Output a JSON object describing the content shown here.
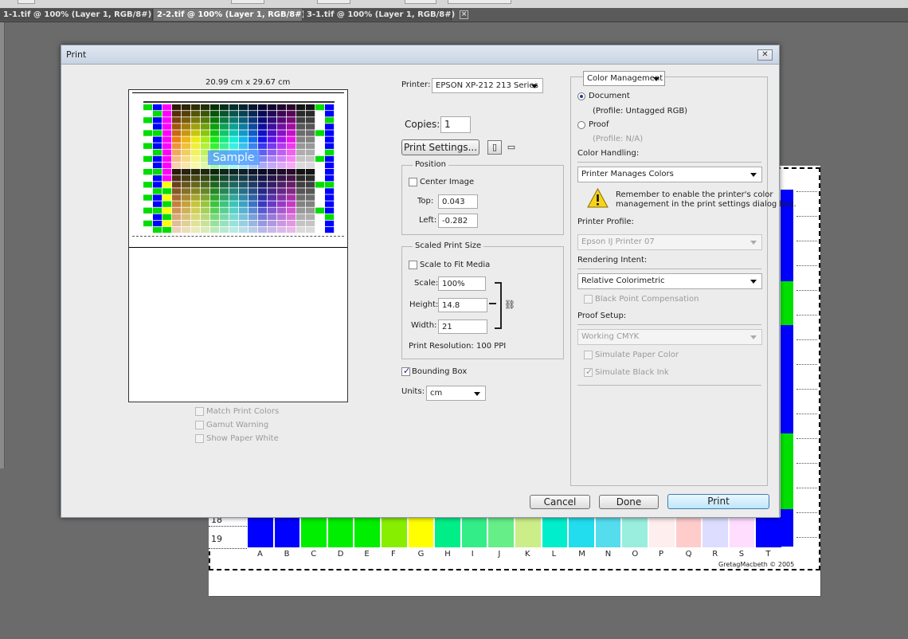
{
  "tabs": [
    {
      "label": "1-1.tif @ 100% (Layer 1, RGB/8#)",
      "active": false
    },
    {
      "label": "2-2.tif @ 100% (Layer 1, RGB/8#)",
      "active": true
    },
    {
      "label": "3-1.tif @ 100% (Layer 1, RGB/8#)",
      "active": false
    }
  ],
  "canvas": {
    "rows": [
      "18",
      "19"
    ],
    "columns": [
      "A",
      "B",
      "C",
      "D",
      "E",
      "F",
      "G",
      "H",
      "I",
      "J",
      "K",
      "L",
      "M",
      "N",
      "O",
      "P",
      "Q",
      "R",
      "S",
      "T"
    ],
    "patch_colors": [
      "#0000ff",
      "#0000ff",
      "#00ee00",
      "#00ee00",
      "#00ee00",
      "#88ee00",
      "#ffff00",
      "#00ee88",
      "#33ee88",
      "#66ee88",
      "#ccee88",
      "#00eecc",
      "#22ddee",
      "#55ddee",
      "#99eedd",
      "#ffeeee",
      "#ffcccc",
      "#ddddff",
      "#ffddff",
      "#0000ff"
    ],
    "credit": "GretagMacbeth © 2005"
  },
  "dialog": {
    "title": "Print",
    "close_glyph": "✕",
    "preview": {
      "size_label": "20.99 cm x 29.67 cm",
      "sample_text": "Sample",
      "match_print_colors": "Match Print Colors",
      "gamut_warning": "Gamut Warning",
      "show_paper_white": "Show Paper White"
    },
    "printer": {
      "label": "Printer:",
      "value": "EPSON XP-212 213 Series",
      "copies_label": "Copies:",
      "copies_value": "1",
      "print_settings_button": "Print Settings...",
      "position": {
        "title": "Position",
        "center_image": "Center Image",
        "top_label": "Top:",
        "top_value": "0.043",
        "left_label": "Left:",
        "left_value": "-0.282"
      },
      "scaled": {
        "title": "Scaled Print Size",
        "scale_to_fit": "Scale to Fit Media",
        "scale_label": "Scale:",
        "scale_value": "100%",
        "height_label": "Height:",
        "height_value": "14.8",
        "width_label": "Width:",
        "width_value": "21",
        "resolution": "Print Resolution: 100 PPI"
      },
      "bounding_box": "Bounding Box",
      "units_label": "Units:",
      "units_value": "cm"
    },
    "color": {
      "section_select": "Color Management",
      "document_label": "Document",
      "document_profile": "(Profile: Untagged RGB)",
      "proof_label": "Proof",
      "proof_profile": "(Profile: N/A)",
      "handling_label": "Color Handling:",
      "handling_value": "Printer Manages Colors",
      "warning_text_1": "Remember to enable the printer's color",
      "warning_text_2": "management in the print settings dialog box.",
      "printer_profile_label": "Printer Profile:",
      "printer_profile_value": "Epson IJ Printer 07",
      "rendering_intent_label": "Rendering Intent:",
      "rendering_intent_value": "Relative Colorimetric",
      "black_point": "Black Point Compensation",
      "proof_setup_label": "Proof Setup:",
      "proof_setup_value": "Working CMYK",
      "simulate_paper": "Simulate Paper Color",
      "simulate_black": "Simulate Black Ink"
    },
    "buttons": {
      "cancel": "Cancel",
      "done": "Done",
      "print": "Print"
    }
  }
}
